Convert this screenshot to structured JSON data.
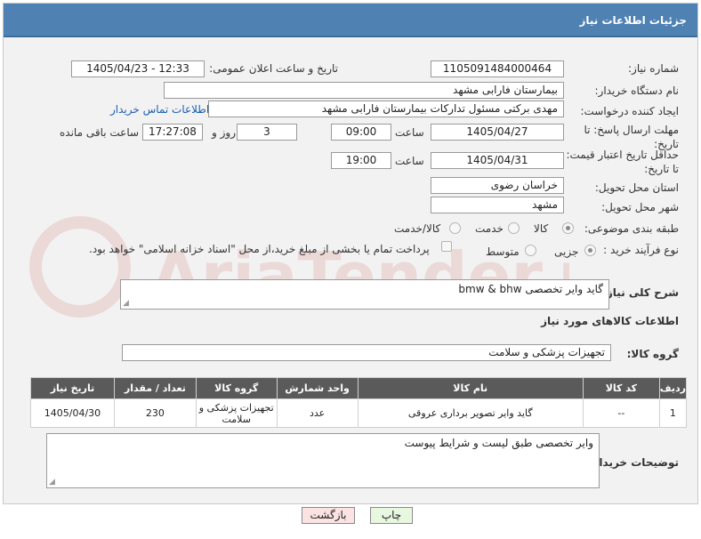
{
  "header": {
    "title": "جزئیات اطلاعات نیاز"
  },
  "fields": {
    "need_number_label": "شماره نیاز:",
    "need_number": "1105091484000464",
    "announce_label": "تاریخ و ساعت اعلان عمومی:",
    "announce_value": "1405/04/23 - 12:33",
    "buyer_org_label": "نام دستگاه خریدار:",
    "buyer_org": "بیمارستان فارابی مشهد",
    "creator_label": "ایجاد کننده درخواست:",
    "creator": "مهدی برکتی مسئول تدارکات بیمارستان فارابی مشهد",
    "contact_link": "اطلاعات تماس خریدار",
    "reply_deadline_label": "مهلت ارسال پاسخ: تا تاریخ:",
    "reply_date": "1405/04/27",
    "time_label": "ساعت",
    "reply_time": "09:00",
    "days_value": "3",
    "days_label": "روز و",
    "remaining_time": "17:27:08",
    "remaining_label": "ساعت باقی مانده",
    "price_deadline_label": "حداقل تاریخ اعتبار قیمت: تا تاریخ:",
    "price_date": "1405/04/31",
    "price_time": "19:00",
    "province_label": "استان محل تحویل:",
    "province": "خراسان رضوی",
    "city_label": "شهر محل تحویل:",
    "city": "مشهد",
    "category_label": "طبقه بندی موضوعی:",
    "category_options": [
      "کالا",
      "خدمت",
      "کالا/خدمت"
    ],
    "process_label": "نوع فرآیند خرید :",
    "process_options": [
      "جزیی",
      "متوسط"
    ],
    "payment_note": "پرداخت تمام یا بخشی از مبلغ خرید،از محل \"اسناد خزانه اسلامی\" خواهد بود.",
    "description_label": "شرح کلی نیاز:",
    "description": "گاید وایر تخصصی bmw & bhw",
    "goods_info_title": "اطلاعات کالاهای مورد نیاز",
    "goods_group_label": "گروه کالا:",
    "goods_group": "تجهیزات پزشکی و سلامت",
    "buyer_notes_label": "توضیحات خریدار:",
    "buyer_notes": "وایر تخصصی طبق لیست و شرایط پیوست"
  },
  "table": {
    "headers": [
      "ردیف",
      "کد کالا",
      "نام کالا",
      "واحد شمارش",
      "گروه کالا",
      "تعداد / مقدار",
      "تاریخ نیاز"
    ],
    "rows": [
      [
        "1",
        "--",
        "گاید وایر تصویر برداری عروقی",
        "عدد",
        "تجهیزات پزشکی و سلامت",
        "230",
        "1405/04/30"
      ]
    ]
  },
  "buttons": {
    "print": "چاپ",
    "back": "بازگشت"
  },
  "watermark": "AriaTender.net",
  "colors": {
    "header": "#4f81b3",
    "table_header": "#5a5a5a",
    "print_btn": "#e8f7e0",
    "back_btn": "#fbe3e3",
    "watermark": "#c0392b"
  }
}
